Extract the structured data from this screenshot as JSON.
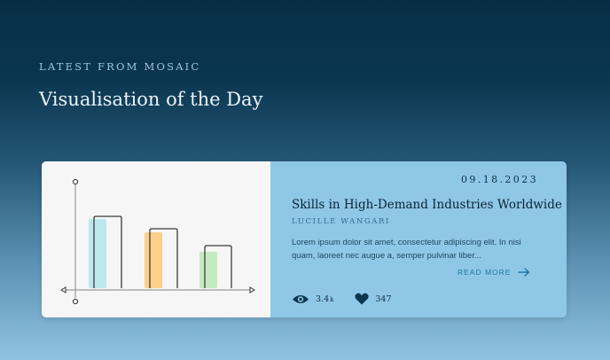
{
  "header": {
    "eyebrow": "LATEST FROM MOSAIC",
    "title": "Visualisation of the Day"
  },
  "card": {
    "date": "09.18.2023",
    "title": "Skills in High-Demand Industries Worldwide",
    "author": "LUCILLE WANGARI",
    "excerpt": "Lorem ipsum dolor sit amet, consectetur adipiscing elit. In nisi quam, laoreet nec augue a, semper pulvinar liber...",
    "read_more": "READ MORE",
    "views": "3.4",
    "views_unit": "k",
    "likes": "347",
    "icons": {
      "views": "eye-icon",
      "likes": "heart-icon",
      "read_more": "arrow-right-icon"
    }
  },
  "colors": {
    "bar_1": "#bde8f0",
    "bar_2": "#fcd08a",
    "bar_3": "#c4ebbf",
    "card_body": "#8fc7e6",
    "link": "#1d78a3"
  }
}
